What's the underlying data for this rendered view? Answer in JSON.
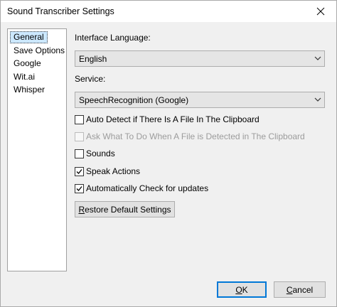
{
  "window": {
    "title": "Sound Transcriber Settings"
  },
  "sidebar": {
    "items": [
      {
        "label": "General",
        "selected": true
      },
      {
        "label": "Save Options",
        "selected": false
      },
      {
        "label": "Google",
        "selected": false
      },
      {
        "label": "Wit.ai",
        "selected": false
      },
      {
        "label": "Whisper",
        "selected": false
      }
    ]
  },
  "general": {
    "language_label": "Interface Language:",
    "language_value": "English",
    "service_label": "Service:",
    "service_value": "SpeechRecognition (Google)",
    "checkboxes": [
      {
        "label": "Auto Detect if There Is A File In The Clipboard",
        "checked": false,
        "enabled": true
      },
      {
        "label": "Ask What To Do When A File is Detected in The Clipboard",
        "checked": false,
        "enabled": false
      },
      {
        "label": "Sounds",
        "checked": false,
        "enabled": true
      },
      {
        "label": "Speak Actions",
        "checked": true,
        "enabled": true
      },
      {
        "label": "Automatically Check for updates",
        "checked": true,
        "enabled": true
      }
    ],
    "restore_first": "R",
    "restore_rest": "estore Default Settings"
  },
  "footer": {
    "ok_first": "O",
    "ok_rest": "K",
    "cancel_first": "C",
    "cancel_rest": "ancel"
  },
  "icons": {
    "close": "close-icon",
    "dropdown": "chevron-down-icon",
    "check": "checkmark-icon"
  },
  "colors": {
    "selection": "#cce8ff",
    "default_button_border": "#0078d7",
    "dialog_background": "#f0f0f0"
  }
}
